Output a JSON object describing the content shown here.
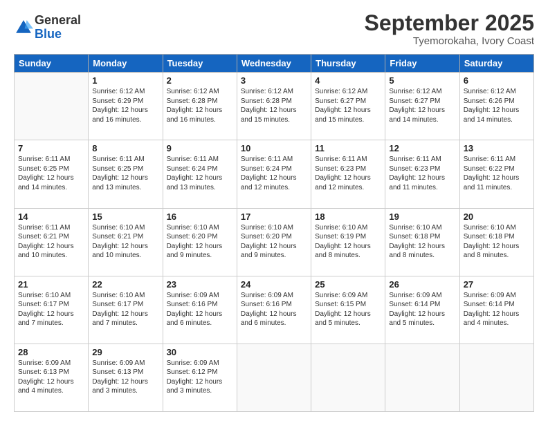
{
  "logo": {
    "general": "General",
    "blue": "Blue"
  },
  "header": {
    "month": "September 2025",
    "location": "Tyemorokaha, Ivory Coast"
  },
  "weekdays": [
    "Sunday",
    "Monday",
    "Tuesday",
    "Wednesday",
    "Thursday",
    "Friday",
    "Saturday"
  ],
  "weeks": [
    [
      {
        "day": "",
        "info": ""
      },
      {
        "day": "1",
        "info": "Sunrise: 6:12 AM\nSunset: 6:29 PM\nDaylight: 12 hours\nand 16 minutes."
      },
      {
        "day": "2",
        "info": "Sunrise: 6:12 AM\nSunset: 6:28 PM\nDaylight: 12 hours\nand 16 minutes."
      },
      {
        "day": "3",
        "info": "Sunrise: 6:12 AM\nSunset: 6:28 PM\nDaylight: 12 hours\nand 15 minutes."
      },
      {
        "day": "4",
        "info": "Sunrise: 6:12 AM\nSunset: 6:27 PM\nDaylight: 12 hours\nand 15 minutes."
      },
      {
        "day": "5",
        "info": "Sunrise: 6:12 AM\nSunset: 6:27 PM\nDaylight: 12 hours\nand 14 minutes."
      },
      {
        "day": "6",
        "info": "Sunrise: 6:12 AM\nSunset: 6:26 PM\nDaylight: 12 hours\nand 14 minutes."
      }
    ],
    [
      {
        "day": "7",
        "info": "Sunrise: 6:11 AM\nSunset: 6:25 PM\nDaylight: 12 hours\nand 14 minutes."
      },
      {
        "day": "8",
        "info": "Sunrise: 6:11 AM\nSunset: 6:25 PM\nDaylight: 12 hours\nand 13 minutes."
      },
      {
        "day": "9",
        "info": "Sunrise: 6:11 AM\nSunset: 6:24 PM\nDaylight: 12 hours\nand 13 minutes."
      },
      {
        "day": "10",
        "info": "Sunrise: 6:11 AM\nSunset: 6:24 PM\nDaylight: 12 hours\nand 12 minutes."
      },
      {
        "day": "11",
        "info": "Sunrise: 6:11 AM\nSunset: 6:23 PM\nDaylight: 12 hours\nand 12 minutes."
      },
      {
        "day": "12",
        "info": "Sunrise: 6:11 AM\nSunset: 6:23 PM\nDaylight: 12 hours\nand 11 minutes."
      },
      {
        "day": "13",
        "info": "Sunrise: 6:11 AM\nSunset: 6:22 PM\nDaylight: 12 hours\nand 11 minutes."
      }
    ],
    [
      {
        "day": "14",
        "info": "Sunrise: 6:11 AM\nSunset: 6:21 PM\nDaylight: 12 hours\nand 10 minutes."
      },
      {
        "day": "15",
        "info": "Sunrise: 6:10 AM\nSunset: 6:21 PM\nDaylight: 12 hours\nand 10 minutes."
      },
      {
        "day": "16",
        "info": "Sunrise: 6:10 AM\nSunset: 6:20 PM\nDaylight: 12 hours\nand 9 minutes."
      },
      {
        "day": "17",
        "info": "Sunrise: 6:10 AM\nSunset: 6:20 PM\nDaylight: 12 hours\nand 9 minutes."
      },
      {
        "day": "18",
        "info": "Sunrise: 6:10 AM\nSunset: 6:19 PM\nDaylight: 12 hours\nand 8 minutes."
      },
      {
        "day": "19",
        "info": "Sunrise: 6:10 AM\nSunset: 6:18 PM\nDaylight: 12 hours\nand 8 minutes."
      },
      {
        "day": "20",
        "info": "Sunrise: 6:10 AM\nSunset: 6:18 PM\nDaylight: 12 hours\nand 8 minutes."
      }
    ],
    [
      {
        "day": "21",
        "info": "Sunrise: 6:10 AM\nSunset: 6:17 PM\nDaylight: 12 hours\nand 7 minutes."
      },
      {
        "day": "22",
        "info": "Sunrise: 6:10 AM\nSunset: 6:17 PM\nDaylight: 12 hours\nand 7 minutes."
      },
      {
        "day": "23",
        "info": "Sunrise: 6:09 AM\nSunset: 6:16 PM\nDaylight: 12 hours\nand 6 minutes."
      },
      {
        "day": "24",
        "info": "Sunrise: 6:09 AM\nSunset: 6:16 PM\nDaylight: 12 hours\nand 6 minutes."
      },
      {
        "day": "25",
        "info": "Sunrise: 6:09 AM\nSunset: 6:15 PM\nDaylight: 12 hours\nand 5 minutes."
      },
      {
        "day": "26",
        "info": "Sunrise: 6:09 AM\nSunset: 6:14 PM\nDaylight: 12 hours\nand 5 minutes."
      },
      {
        "day": "27",
        "info": "Sunrise: 6:09 AM\nSunset: 6:14 PM\nDaylight: 12 hours\nand 4 minutes."
      }
    ],
    [
      {
        "day": "28",
        "info": "Sunrise: 6:09 AM\nSunset: 6:13 PM\nDaylight: 12 hours\nand 4 minutes."
      },
      {
        "day": "29",
        "info": "Sunrise: 6:09 AM\nSunset: 6:13 PM\nDaylight: 12 hours\nand 3 minutes."
      },
      {
        "day": "30",
        "info": "Sunrise: 6:09 AM\nSunset: 6:12 PM\nDaylight: 12 hours\nand 3 minutes."
      },
      {
        "day": "",
        "info": ""
      },
      {
        "day": "",
        "info": ""
      },
      {
        "day": "",
        "info": ""
      },
      {
        "day": "",
        "info": ""
      }
    ]
  ]
}
